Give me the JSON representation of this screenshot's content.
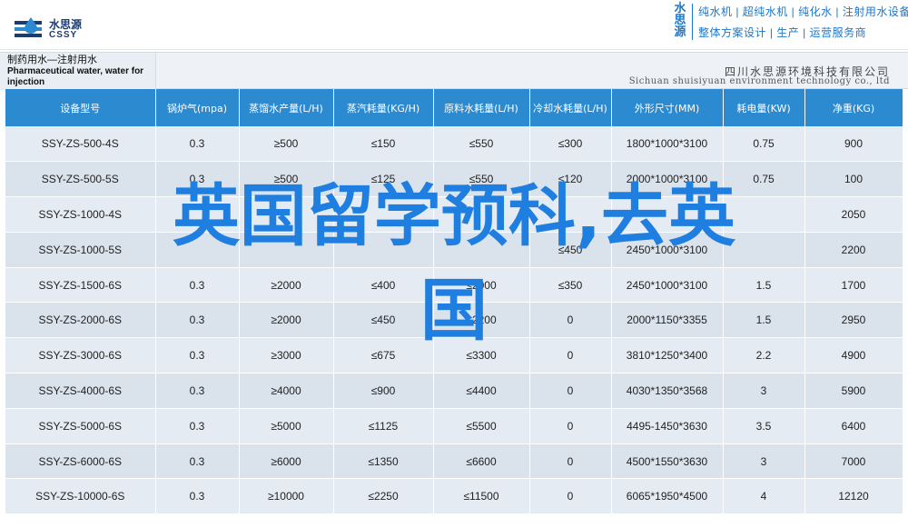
{
  "header": {
    "logo_cn": "水思源",
    "logo_en": "CSSY",
    "brand_vertical": [
      "水",
      "思",
      "源"
    ],
    "brand_line1": "纯水机 | 超纯水机 | 纯化水 | 注射用水设备",
    "brand_line2": "整体方案设计 | 生产 | 运营服务商"
  },
  "title": {
    "cn": "制药用水—注射用水",
    "en1": "Pharmaceutical water, water for",
    "en2": "injection",
    "company_cn": "四川水思源环境科技有限公司",
    "company_en": "Sichuan shuisiyuan environment technology co., ltd"
  },
  "table": {
    "headers": [
      "设备型号",
      "锅炉气(mpa)",
      "蒸馏水产量(L/H)",
      "蒸汽耗量(KG/H)",
      "原料水耗量(L/H)",
      "冷却水耗量(L/H)",
      "外形尺寸(MM)",
      "耗电量(KW)",
      "净重(KG)"
    ],
    "rows": [
      [
        "SSY-ZS-500-4S",
        "0.3",
        "≥500",
        "≤150",
        "≤550",
        "≤300",
        "1800*1000*3100",
        "0.75",
        "900"
      ],
      [
        "SSY-ZS-500-5S",
        "0.3",
        "≥500",
        "≤125",
        "≤550",
        "≤120",
        "2000*1000*3100",
        "0.75",
        "100"
      ],
      [
        "SSY-ZS-1000-4S",
        "",
        "",
        "",
        "",
        "",
        "",
        "",
        "2050"
      ],
      [
        "SSY-ZS-1000-5S",
        "",
        "",
        "",
        "",
        "≤450",
        "2450*1000*3100",
        "",
        "2200"
      ],
      [
        "SSY-ZS-1500-6S",
        "0.3",
        "≥2000",
        "≤400",
        "≤2000",
        "≤350",
        "2450*1000*3100",
        "1.5",
        "1700"
      ],
      [
        "SSY-ZS-2000-6S",
        "0.3",
        "≥2000",
        "≤450",
        "≤2200",
        "0",
        "2000*1150*3355",
        "1.5",
        "2950"
      ],
      [
        "SSY-ZS-3000-6S",
        "0.3",
        "≥3000",
        "≤675",
        "≤3300",
        "0",
        "3810*1250*3400",
        "2.2",
        "4900"
      ],
      [
        "SSY-ZS-4000-6S",
        "0.3",
        "≥4000",
        "≤900",
        "≤4400",
        "0",
        "4030*1350*3568",
        "3",
        "5900"
      ],
      [
        "SSY-ZS-5000-6S",
        "0.3",
        "≥5000",
        "≤1125",
        "≤5500",
        "0",
        "4495-1450*3630",
        "3.5",
        "6400"
      ],
      [
        "SSY-ZS-6000-6S",
        "0.3",
        "≥6000",
        "≤1350",
        "≤6600",
        "0",
        "4500*1550*3630",
        "3",
        "7000"
      ],
      [
        "SSY-ZS-10000-6S",
        "0.3",
        "≥10000",
        "≤2250",
        "≤11500",
        "0",
        "6065*1950*4500",
        "4",
        "12120"
      ]
    ]
  },
  "overlay": {
    "line1": "英国留学预科,去英",
    "line2": "国"
  },
  "colors": {
    "header_blue": "#2c8bd0",
    "overlay_blue": "#1f7fe0",
    "brand_blue": "#1d77c8"
  },
  "icons": {
    "logo": "water-drop-logo-icon"
  }
}
